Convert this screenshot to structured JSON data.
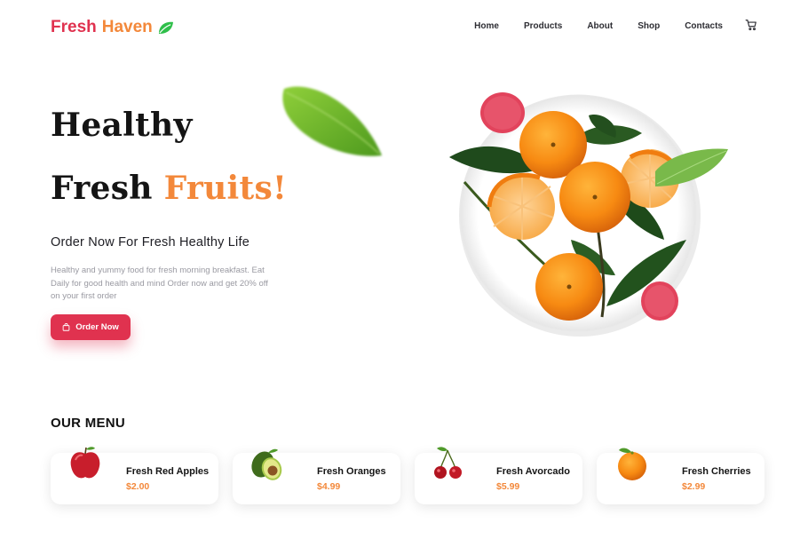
{
  "brand": {
    "word1": "Fresh",
    "word2": "Haven",
    "icon": "leaf-icon"
  },
  "nav": {
    "items": [
      {
        "label": "Home"
      },
      {
        "label": "Products"
      },
      {
        "label": "About"
      },
      {
        "label": "Shop"
      },
      {
        "label": "Contacts"
      }
    ],
    "cart_icon": "shopping-cart-icon"
  },
  "hero": {
    "line1": "Healthy",
    "line2_plain": "Fresh",
    "line2_accent": "Fruits!",
    "subheading": "Order Now For Fresh Healthy Life",
    "description": "Healthy and yummy food for fresh morning breakfast. Eat Daily for good health and mind Order now and get 20% off on your first order",
    "cta_label": "Order Now",
    "cta_icon": "shopping-bag-icon"
  },
  "menu": {
    "title": "OUR MENU",
    "items": [
      {
        "name": "Fresh Red Apples",
        "price": "$2.00",
        "icon": "apple-icon"
      },
      {
        "name": "Fresh Oranges",
        "price": "$4.99",
        "icon": "avocado-icon"
      },
      {
        "name": "Fresh Avorcado",
        "price": "$5.99",
        "icon": "cherries-icon"
      },
      {
        "name": "Fresh Cherries",
        "price": "$2.99",
        "icon": "orange-icon"
      }
    ]
  },
  "colors": {
    "primary": "#e0324f",
    "accent": "#f3883a",
    "muted": "#9a9aa2"
  }
}
